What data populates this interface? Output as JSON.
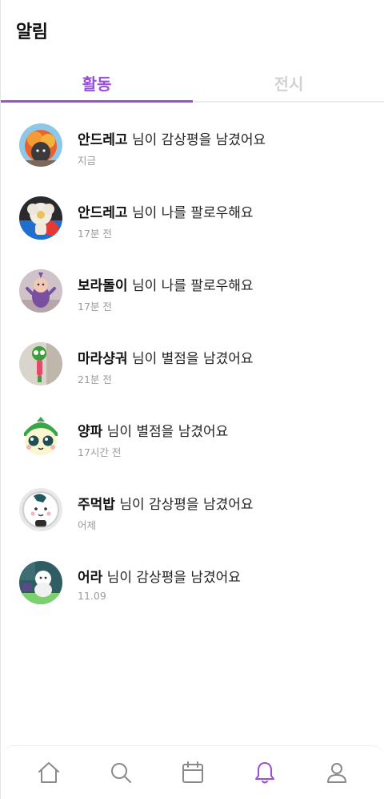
{
  "header": {
    "title": "알림"
  },
  "tabs": [
    {
      "label": "활동",
      "active": true
    },
    {
      "label": "전시",
      "active": false
    }
  ],
  "notifications": [
    {
      "nickname": "안드레고",
      "message": " 님이 감상평을 남겼어요",
      "time": "지금"
    },
    {
      "nickname": "안드레고",
      "message": " 님이 나를 팔로우해요",
      "time": "17분 전"
    },
    {
      "nickname": "보라돌이",
      "message": " 님이 나를 팔로우해요",
      "time": "17분 전"
    },
    {
      "nickname": "마라샹궈",
      "message": " 님이 별점을 남겼어요",
      "time": "21분 전"
    },
    {
      "nickname": "양파",
      "message": " 님이 별점을 남겼어요",
      "time": "17시간 전"
    },
    {
      "nickname": "주먹밥",
      "message": " 님이 감상평을 남겼어요",
      "time": "어제"
    },
    {
      "nickname": "어라",
      "message": " 님이 감상평을 남겼어요",
      "time": "11.09"
    }
  ],
  "bottom_nav": [
    {
      "icon": "home-icon",
      "active": false
    },
    {
      "icon": "search-icon",
      "active": false
    },
    {
      "icon": "calendar-icon",
      "active": false
    },
    {
      "icon": "bell-icon",
      "active": true
    },
    {
      "icon": "user-icon",
      "active": false
    }
  ],
  "colors": {
    "accent": "#9b4de0",
    "inactive_tab": "#d2d2d2",
    "icon_gray": "#8a8a8a",
    "time_text": "#9a9a9a"
  }
}
